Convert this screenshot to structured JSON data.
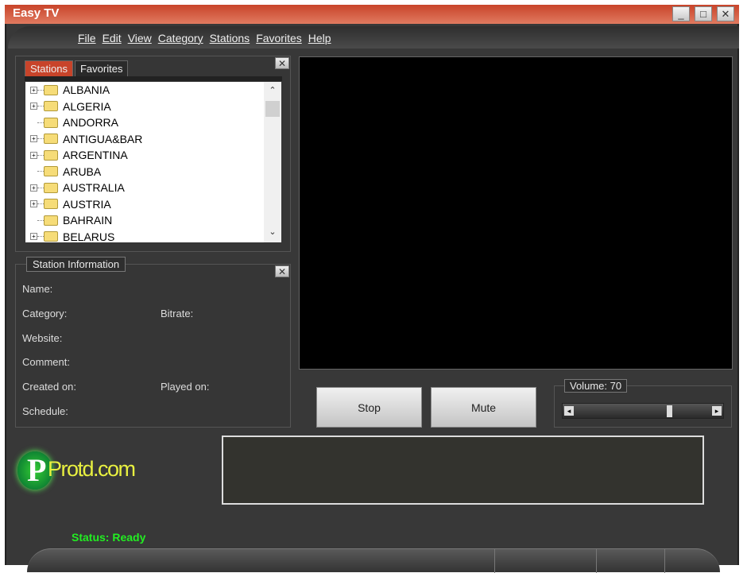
{
  "window": {
    "title": "Easy TV",
    "minimize": "_",
    "maximize": "□",
    "close": "✕"
  },
  "menu": [
    "File",
    "Edit",
    "View",
    "Category",
    "Stations",
    "Favorites",
    "Help"
  ],
  "tabs": {
    "stations": "Stations",
    "favorites": "Favorites"
  },
  "tree": [
    "ALBANIA",
    "ALGERIA",
    "ANDORRA",
    "ANTIGUA&BAR",
    "ARGENTINA",
    "ARUBA",
    "AUSTRALIA",
    "AUSTRIA",
    "BAHRAIN",
    "BELARUS"
  ],
  "tree_expandable": [
    true,
    true,
    false,
    true,
    true,
    false,
    true,
    true,
    false,
    true
  ],
  "station_info": {
    "title": "Station Information",
    "name": "Name:",
    "category": "Category:",
    "bitrate": "Bitrate:",
    "website": "Website:",
    "comment": "Comment:",
    "created": "Created on:",
    "played": "Played on:",
    "schedule": "Schedule:"
  },
  "controls": {
    "stop": "Stop",
    "mute": "Mute",
    "volume_label": "Volume: 70",
    "volume": 70
  },
  "logo": "Protd.com",
  "status": "Status: Ready",
  "colors": {
    "accent": "#c8442a",
    "status": "#22ee22"
  }
}
